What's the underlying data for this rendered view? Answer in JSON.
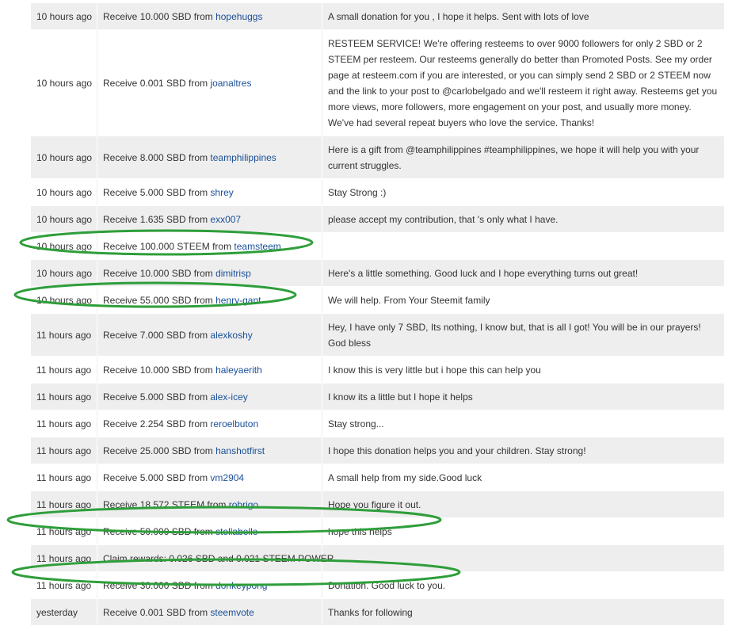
{
  "transactions": [
    {
      "time": "10 hours ago",
      "prefix": "Receive 10.000 SBD from",
      "user": "hopehuggs",
      "memo": "A small donation for you , I hope it helps. Sent with lots of love"
    },
    {
      "time": "10 hours ago",
      "prefix": "Receive 0.001 SBD from",
      "user": "joanaltres",
      "memo": "RESTEEM SERVICE! We're offering resteems to over 9000 followers for only 2 SBD or 2 STEEM per resteem. Our resteems generally do better than Promoted Posts. See my order page at resteem.com if you are interested, or you can simply send 2 SBD or 2 STEEM now and the link to your post to @carlobelgado and we'll resteem it right away. Resteems get you more views, more followers, more engagement on your post, and usually more money. We've had several repeat buyers who love the service. Thanks!"
    },
    {
      "time": "10 hours ago",
      "prefix": "Receive 8.000 SBD from",
      "user": "teamphilippines",
      "memo": "Here is a gift from @teamphilippines #teamphilippines, we hope it will help you with your current struggles."
    },
    {
      "time": "10 hours ago",
      "prefix": "Receive 5.000 SBD from",
      "user": "shrey",
      "memo": "Stay Strong :)"
    },
    {
      "time": "10 hours ago",
      "prefix": "Receive 1.635 SBD from",
      "user": "exx007",
      "memo": "please accept my contribution, that 's only what I have."
    },
    {
      "time": "10 hours ago",
      "prefix": "Receive 100.000 STEEM from",
      "user": "teamsteem",
      "memo": ""
    },
    {
      "time": "10 hours ago",
      "prefix": "Receive 10.000 SBD from",
      "user": "dimitrisp",
      "memo": "Here's a little something. Good luck and I hope everything turns out great!"
    },
    {
      "time": "10 hours ago",
      "prefix": "Receive 55.000 SBD from",
      "user": "henry-gant",
      "memo": "We will help. From Your Steemit family"
    },
    {
      "time": "11 hours ago",
      "prefix": "Receive 7.000 SBD from",
      "user": "alexkoshy",
      "memo": "Hey, I have only 7 SBD, Its nothing, I know but, that is all I got! You will be in our prayers! God bless"
    },
    {
      "time": "11 hours ago",
      "prefix": "Receive 10.000 SBD from",
      "user": "haleyaerith",
      "memo": "I know this is very little but i hope this can help you"
    },
    {
      "time": "11 hours ago",
      "prefix": "Receive 5.000 SBD from",
      "user": "alex-icey",
      "memo": "I know its a little but I hope it helps"
    },
    {
      "time": "11 hours ago",
      "prefix": "Receive 2.254 SBD from",
      "user": "reroelbuton",
      "memo": "Stay strong..."
    },
    {
      "time": "11 hours ago",
      "prefix": "Receive 25.000 SBD from",
      "user": "hanshotfirst",
      "memo": "I hope this donation helps you and your children. Stay strong!"
    },
    {
      "time": "11 hours ago",
      "prefix": "Receive 5.000 SBD from",
      "user": "vm2904",
      "memo": "A small help from my side.Good luck"
    },
    {
      "time": "11 hours ago",
      "prefix": "Receive 18.572 STEEM from",
      "user": "robrigo",
      "memo": "Hope you figure it out."
    },
    {
      "time": "11 hours ago",
      "prefix": "Receive 50.000 SBD from",
      "user": "stellabelle",
      "memo": "hope this helps"
    },
    {
      "time": "11 hours ago",
      "prefix": "Claim rewards: 0.026 SBD and 0.021 STEEM POWER",
      "user": "",
      "memo": ""
    },
    {
      "time": "11 hours ago",
      "prefix": "Receive 30.000 SBD from",
      "user": "donkeypong",
      "memo": "Donation. Good luck to you."
    },
    {
      "time": "yesterday",
      "prefix": "Receive 0.001 SBD from",
      "user": "steemvote",
      "memo": "Thanks for following"
    }
  ],
  "colors": {
    "link": "#1a5099",
    "stripe": "#eeeeee",
    "highlight_ring": "#2e9e3a"
  }
}
